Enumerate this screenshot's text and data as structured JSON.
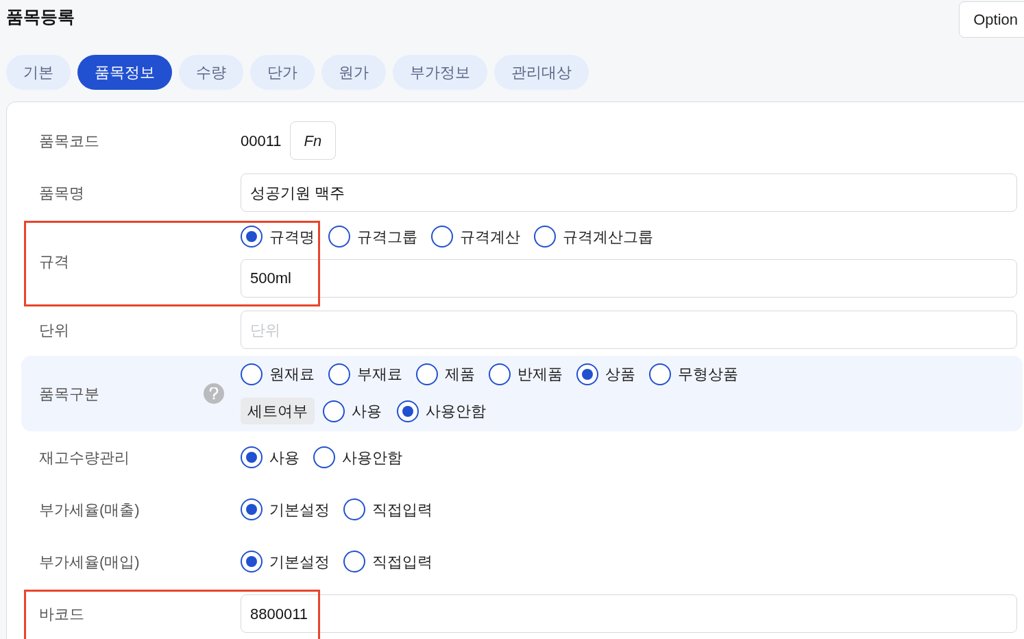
{
  "title": "품목등록",
  "option_button": "Option",
  "tabs": [
    {
      "label": "기본",
      "selected": false
    },
    {
      "label": "품목정보",
      "selected": true
    },
    {
      "label": "수량",
      "selected": false
    },
    {
      "label": "단가",
      "selected": false
    },
    {
      "label": "원가",
      "selected": false
    },
    {
      "label": "부가정보",
      "selected": false
    },
    {
      "label": "관리대상",
      "selected": false
    }
  ],
  "rows": [
    {
      "kind": "code",
      "label": "품목코드",
      "value": "00011",
      "button": "Fn",
      "highlighted": false
    },
    {
      "kind": "input",
      "label": "품목명",
      "value": "성공기원 맥주",
      "highlighted": false
    },
    {
      "kind": "spec",
      "label": "규격",
      "options": [
        {
          "label": "규격명",
          "selected": true
        },
        {
          "label": "규격그룹",
          "selected": false
        },
        {
          "label": "규격계산",
          "selected": false
        },
        {
          "label": "규격계산그룹",
          "selected": false
        }
      ],
      "value": "500ml",
      "highlighted": true
    },
    {
      "kind": "input",
      "label": "단위",
      "placeholder": "단위",
      "highlighted": false
    },
    {
      "kind": "category",
      "label": "품목구분",
      "options": [
        {
          "label": "원재료",
          "selected": false
        },
        {
          "label": "부재료",
          "selected": false
        },
        {
          "label": "제품",
          "selected": false
        },
        {
          "label": "반제품",
          "selected": false
        },
        {
          "label": "상품",
          "selected": true
        },
        {
          "label": "무형상품",
          "selected": false
        }
      ],
      "set_label": "세트여부",
      "set_options": [
        {
          "label": "사용",
          "selected": false
        },
        {
          "label": "사용안함",
          "selected": true
        }
      ],
      "highlighted": false
    },
    {
      "kind": "radio",
      "label": "재고수량관리",
      "options": [
        {
          "label": "사용",
          "selected": true
        },
        {
          "label": "사용안함",
          "selected": false
        }
      ],
      "highlighted": false
    },
    {
      "kind": "radio",
      "label": "부가세율(매출)",
      "options": [
        {
          "label": "기본설정",
          "selected": true
        },
        {
          "label": "직접입력",
          "selected": false
        }
      ],
      "highlighted": false
    },
    {
      "kind": "radio",
      "label": "부가세율(매입)",
      "options": [
        {
          "label": "기본설정",
          "selected": true
        },
        {
          "label": "직접입력",
          "selected": false
        }
      ],
      "highlighted": false
    },
    {
      "kind": "input",
      "label": "바코드",
      "value": "8800011",
      "highlighted": true
    }
  ]
}
